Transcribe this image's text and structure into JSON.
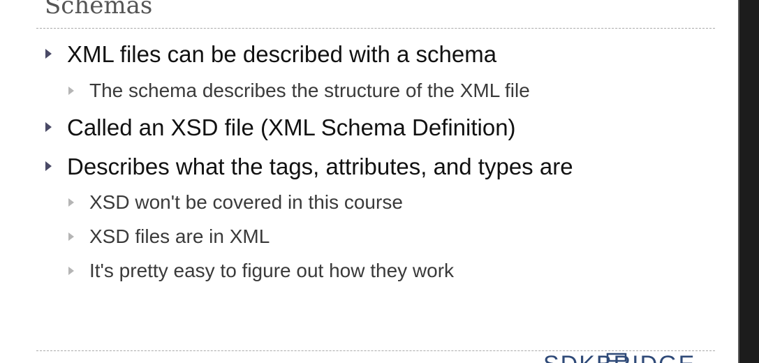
{
  "slide": {
    "title": "Schemas",
    "bullets": [
      {
        "level": 1,
        "text": "XML files can be described with a schema"
      },
      {
        "level": 2,
        "text": "The schema describes the structure of the XML file"
      },
      {
        "level": 1,
        "text": "Called an XSD file (XML Schema Definition)"
      },
      {
        "level": 1,
        "text": "Describes what the tags, attributes, and types are"
      },
      {
        "level": 2,
        "text": "XSD won't be covered in this course"
      },
      {
        "level": 2,
        "text": "XSD files are in XML"
      },
      {
        "level": 2,
        "text": "It's pretty easy to figure out how they work"
      }
    ]
  },
  "footer": {
    "logo_text": "SDKBRIDGE"
  },
  "colors": {
    "level1_text": "#111111",
    "level2_text": "#3a3a3a",
    "level1_marker": "#4a4a66",
    "level2_marker": "#b5b5b5",
    "rule": "#a9a9a9",
    "logo": "#2f4a78"
  }
}
